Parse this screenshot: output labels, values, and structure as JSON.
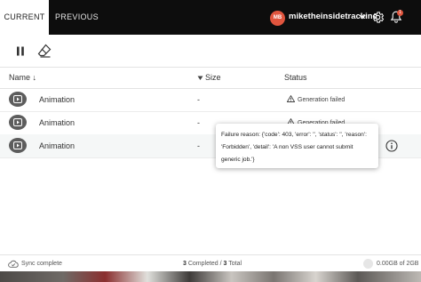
{
  "tabs": [
    {
      "label": "CURRENT",
      "active": true
    },
    {
      "label": "PREVIOUS",
      "active": false
    }
  ],
  "user": {
    "initials": "MB",
    "name": "miketheinsidetrackinc",
    "avatar_color": "#e0553e"
  },
  "notifications": {
    "count": "1"
  },
  "columns": {
    "name": "Name ↓",
    "size": "Size",
    "status": "Status"
  },
  "rows": [
    {
      "name": "Animation",
      "size": "-",
      "status": "Generation failed"
    },
    {
      "name": "Animation",
      "size": "-",
      "status": "Generation failed"
    },
    {
      "name": "Animation",
      "size": "-",
      "status": ""
    }
  ],
  "tooltip": {
    "text": "Failure reason: {'code': 403, 'error': '', 'status': '', 'reason': 'Forbidden', 'detail': 'A non VSS user cannot submit generic job.'}"
  },
  "footer": {
    "sync": "Sync complete",
    "completed": "3",
    "completed_label": " Completed / ",
    "total": "3",
    "total_label": " Total",
    "storage": "0.00GB of 2GB"
  }
}
